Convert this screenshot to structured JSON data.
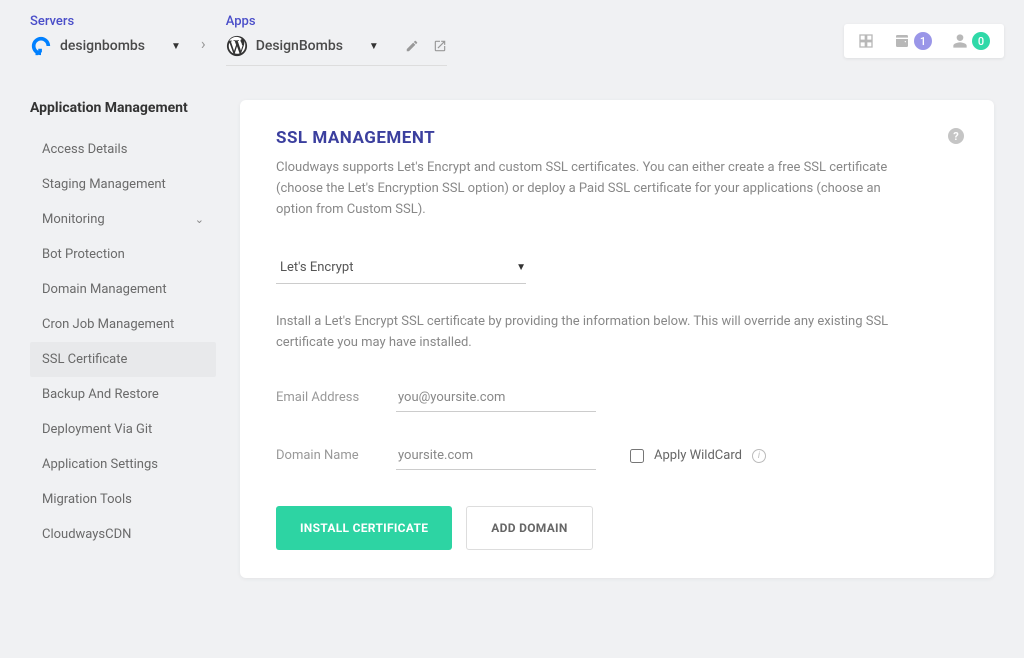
{
  "breadcrumb": {
    "servers_label": "Servers",
    "server_name": "designbombs",
    "apps_label": "Apps",
    "app_name": "DesignBombs"
  },
  "top_right": {
    "wallet_badge": "1",
    "user_badge": "0"
  },
  "sidebar": {
    "title": "Application Management",
    "items": [
      {
        "label": "Access Details"
      },
      {
        "label": "Staging Management"
      },
      {
        "label": "Monitoring",
        "expandable": true
      },
      {
        "label": "Bot Protection"
      },
      {
        "label": "Domain Management"
      },
      {
        "label": "Cron Job Management"
      },
      {
        "label": "SSL Certificate",
        "active": true
      },
      {
        "label": "Backup And Restore"
      },
      {
        "label": "Deployment Via Git"
      },
      {
        "label": "Application Settings"
      },
      {
        "label": "Migration Tools"
      },
      {
        "label": "CloudwaysCDN"
      }
    ]
  },
  "main": {
    "title": "SSL MANAGEMENT",
    "description": "Cloudways supports Let's Encrypt and custom SSL certificates. You can either create a free SSL certificate (choose the Let's Encryption SSL option) or deploy a Paid SSL certificate for your applications (choose an option from Custom SSL).",
    "ssl_type_selected": "Let's Encrypt",
    "sub_description": "Install a Let's Encrypt SSL certificate by providing the information below. This will override any existing SSL certificate you may have installed.",
    "email_label": "Email Address",
    "email_placeholder": "you@yoursite.com",
    "domain_label": "Domain Name",
    "domain_placeholder": "yoursite.com",
    "wildcard_label": "Apply WildCard",
    "install_button": "INSTALL CERTIFICATE",
    "add_domain_button": "ADD DOMAIN"
  }
}
